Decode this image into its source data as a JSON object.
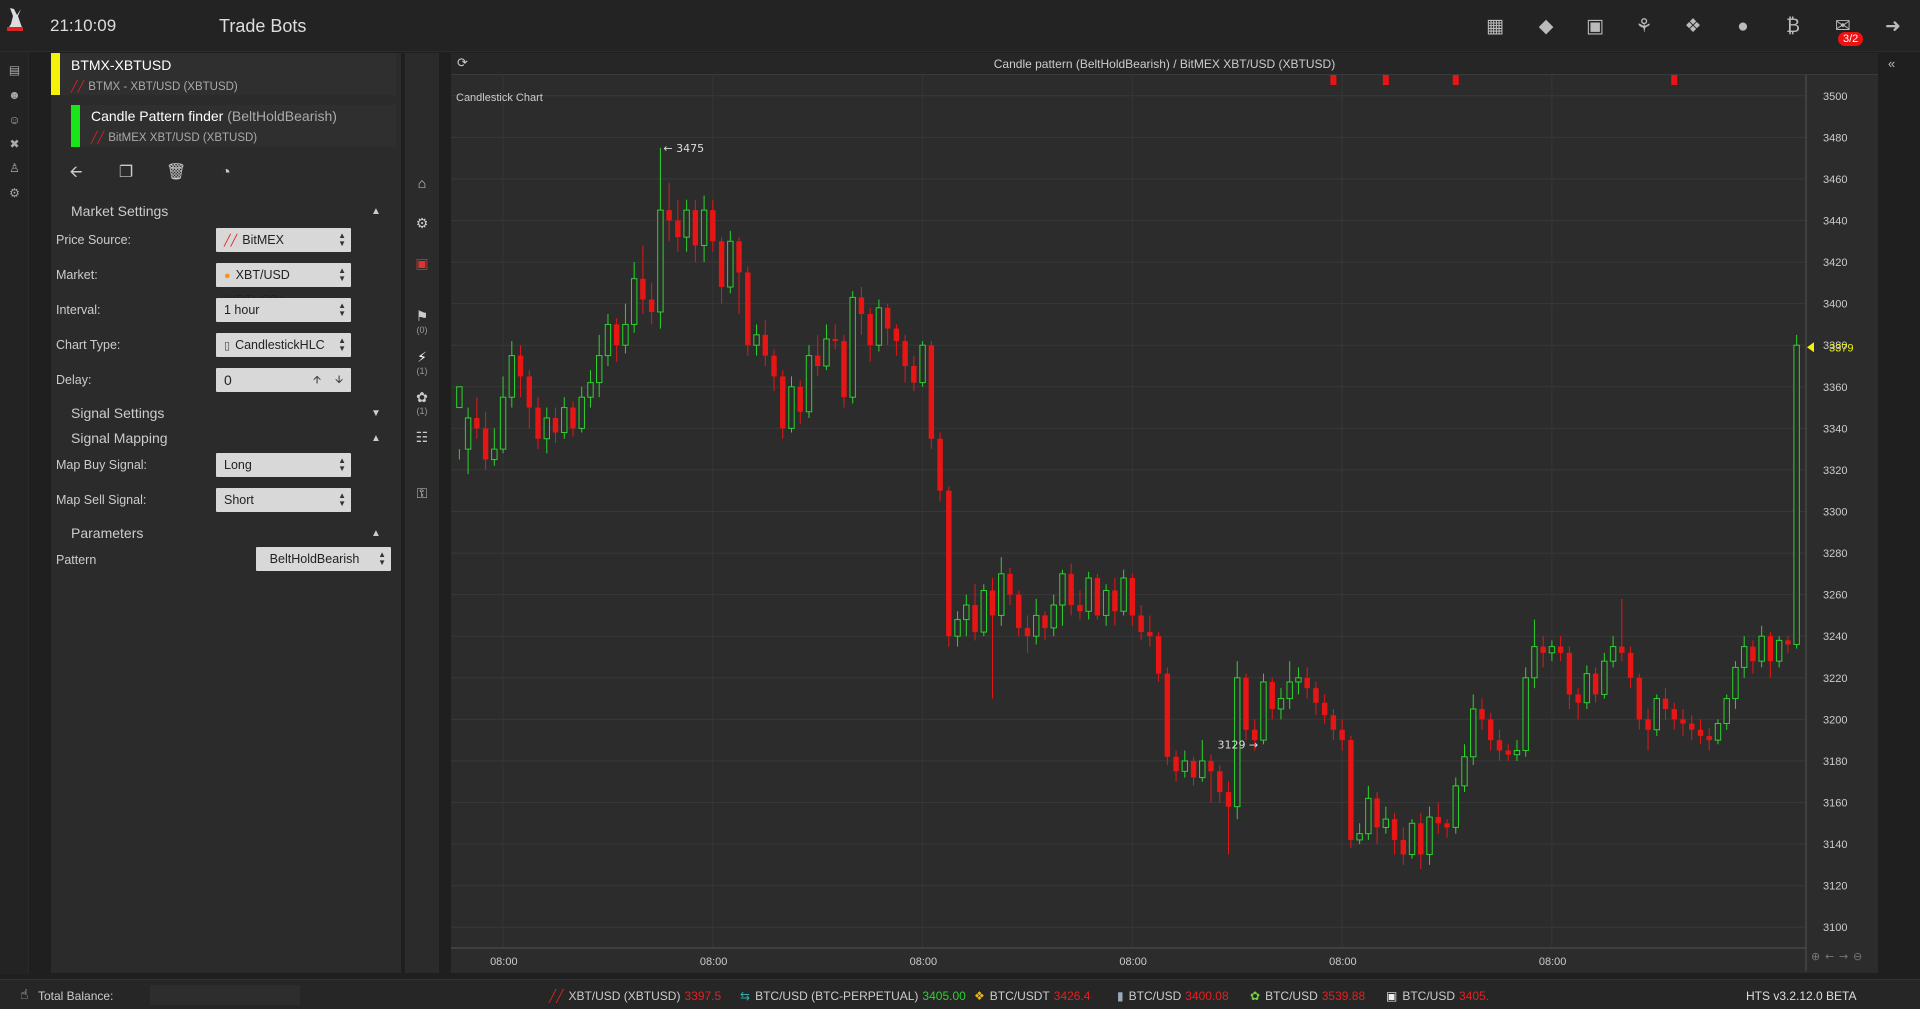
{
  "header": {
    "clock": "21:10:09",
    "title": "Trade Bots",
    "icons": [
      "map-icon",
      "ticket-icon",
      "frame-icon",
      "bell-icon",
      "tag-icon",
      "coins-icon",
      "bitcoin-refresh-icon",
      "inbox-icon",
      "logout-icon"
    ],
    "notification_badge": "3/2"
  },
  "rail": {
    "icons": [
      "monitor-icon",
      "bot-icon",
      "bot-alt-icon",
      "tools-icon",
      "user-icon",
      "cogs-icon"
    ]
  },
  "bots": [
    {
      "name": "BTMX-XBTUSD",
      "subtitle": "BTMX - XBT/USD (XBTUSD)",
      "strip_color": "#f2f20a"
    },
    {
      "name": "Candle Pattern finder",
      "name_suffix": "(BeltHoldBearish)",
      "subtitle": "BitMEX XBT/USD (XBTUSD)",
      "strip_color": "#19e619"
    }
  ],
  "toolbar": {
    "icons": [
      "back-arrow-icon",
      "copy-icon",
      "trash-icon",
      "dashboard-icon"
    ]
  },
  "sections": {
    "market_settings": "Market Settings",
    "signal_settings": "Signal Settings",
    "signal_mapping": "Signal Mapping",
    "parameters": "Parameters"
  },
  "fields": {
    "price_source": {
      "label": "Price Source:",
      "value": "BitMEX"
    },
    "market": {
      "label": "Market:",
      "value": "XBT/USD (XBTUSD)"
    },
    "interval": {
      "label": "Interval:",
      "value": "1 hour"
    },
    "chart_type": {
      "label": "Chart Type:",
      "value": "CandlestickHLC"
    },
    "delay": {
      "label": "Delay:",
      "value": "0"
    },
    "map_buy": {
      "label": "Map Buy Signal:",
      "value": "Long"
    },
    "map_sell": {
      "label": "Map Sell Signal:",
      "value": "Short"
    },
    "pattern": {
      "label": "Pattern",
      "value": "BeltHoldBearish"
    }
  },
  "tool_rail": {
    "icons": [
      "home-icon",
      "cogs-icon",
      "money-icon",
      "flag-icon",
      "bolt-icon",
      "leaf-icon",
      "sitemap-icon",
      "unlock-icon"
    ],
    "counts": {
      "flag": "(0)",
      "bolt": "(1)",
      "leaf": "(1)"
    }
  },
  "chart_panel": {
    "title": "Candle pattern (BeltHoldBearish) / BitMEX XBT/USD (XBTUSD)"
  },
  "chart_data": {
    "type": "candlestick",
    "title": "Candlestick Chart",
    "ylim": [
      3090,
      3510
    ],
    "y_ticks": [
      3100,
      3120,
      3140,
      3160,
      3180,
      3200,
      3220,
      3240,
      3260,
      3280,
      3300,
      3320,
      3340,
      3360,
      3380,
      3400,
      3420,
      3440,
      3460,
      3480,
      3500
    ],
    "x_tick_labels": [
      "08:00",
      "08:00",
      "08:00",
      "08:00",
      "08:00",
      "08:00"
    ],
    "x_tick_indices": [
      5,
      29,
      53,
      77,
      101,
      125
    ],
    "current_price": 3379,
    "high_marker": {
      "label": "3475",
      "index": 23
    },
    "low_marker": {
      "label": "3129",
      "index": 92
    },
    "signal_markers": [
      100,
      106,
      114,
      139
    ],
    "colors": {
      "up": "#2bd32b",
      "down": "#e81515"
    },
    "candles": [
      [
        3350,
        3360,
        3330,
        3325
      ],
      [
        3330,
        3345,
        3350,
        3318
      ],
      [
        3345,
        3340,
        3355,
        3335
      ],
      [
        3340,
        3325,
        3348,
        3320
      ],
      [
        3325,
        3330,
        3340,
        3322
      ],
      [
        3330,
        3355,
        3365,
        3328
      ],
      [
        3355,
        3375,
        3382,
        3350
      ],
      [
        3375,
        3365,
        3380,
        3355
      ],
      [
        3365,
        3350,
        3368,
        3340
      ],
      [
        3350,
        3335,
        3355,
        3330
      ],
      [
        3335,
        3345,
        3350,
        3328
      ],
      [
        3345,
        3338,
        3350,
        3333
      ],
      [
        3338,
        3350,
        3355,
        3335
      ],
      [
        3350,
        3340,
        3353,
        3336
      ],
      [
        3340,
        3355,
        3360,
        3338
      ],
      [
        3355,
        3362,
        3368,
        3350
      ],
      [
        3362,
        3375,
        3385,
        3355
      ],
      [
        3375,
        3390,
        3395,
        3370
      ],
      [
        3390,
        3380,
        3393,
        3372
      ],
      [
        3380,
        3390,
        3400,
        3376
      ],
      [
        3390,
        3412,
        3420,
        3386
      ],
      [
        3412,
        3402,
        3428,
        3395
      ],
      [
        3402,
        3396,
        3410,
        3390
      ],
      [
        3396,
        3445,
        3475,
        3388
      ],
      [
        3445,
        3440,
        3458,
        3430
      ],
      [
        3440,
        3432,
        3450,
        3425
      ],
      [
        3432,
        3445,
        3450,
        3425
      ],
      [
        3445,
        3428,
        3450,
        3420
      ],
      [
        3428,
        3445,
        3452,
        3420
      ],
      [
        3445,
        3430,
        3450,
        3425
      ],
      [
        3430,
        3408,
        3432,
        3400
      ],
      [
        3408,
        3430,
        3435,
        3405
      ],
      [
        3430,
        3415,
        3432,
        3395
      ],
      [
        3415,
        3380,
        3418,
        3375
      ],
      [
        3380,
        3385,
        3390,
        3375
      ],
      [
        3385,
        3375,
        3392,
        3370
      ],
      [
        3375,
        3365,
        3378,
        3358
      ],
      [
        3365,
        3340,
        3368,
        3335
      ],
      [
        3340,
        3360,
        3365,
        3338
      ],
      [
        3360,
        3348,
        3363,
        3342
      ],
      [
        3348,
        3375,
        3380,
        3345
      ],
      [
        3375,
        3370,
        3385,
        3365
      ],
      [
        3370,
        3383,
        3390,
        3368
      ],
      [
        3383,
        3382,
        3390,
        3378
      ],
      [
        3382,
        3355,
        3385,
        3350
      ],
      [
        3355,
        3403,
        3406,
        3352
      ],
      [
        3403,
        3395,
        3408,
        3385
      ],
      [
        3395,
        3380,
        3398,
        3372
      ],
      [
        3380,
        3398,
        3402,
        3377
      ],
      [
        3398,
        3388,
        3400,
        3380
      ],
      [
        3388,
        3382,
        3390,
        3375
      ],
      [
        3382,
        3370,
        3385,
        3362
      ],
      [
        3370,
        3362,
        3375,
        3358
      ],
      [
        3362,
        3380,
        3382,
        3360
      ],
      [
        3380,
        3335,
        3382,
        3330
      ],
      [
        3335,
        3310,
        3338,
        3305
      ],
      [
        3310,
        3240,
        3312,
        3235
      ],
      [
        3240,
        3248,
        3252,
        3235
      ],
      [
        3248,
        3255,
        3260,
        3240
      ],
      [
        3255,
        3242,
        3265,
        3238
      ],
      [
        3242,
        3262,
        3265,
        3240
      ],
      [
        3262,
        3250,
        3268,
        3210
      ],
      [
        3250,
        3270,
        3278,
        3245
      ],
      [
        3270,
        3260,
        3273,
        3255
      ],
      [
        3260,
        3244,
        3262,
        3240
      ],
      [
        3244,
        3240,
        3250,
        3232
      ],
      [
        3240,
        3250,
        3258,
        3236
      ],
      [
        3250,
        3244,
        3252,
        3238
      ],
      [
        3244,
        3255,
        3260,
        3240
      ],
      [
        3255,
        3270,
        3272,
        3245
      ],
      [
        3270,
        3255,
        3275,
        3250
      ],
      [
        3255,
        3252,
        3262,
        3248
      ],
      [
        3252,
        3268,
        3271,
        3248
      ],
      [
        3268,
        3250,
        3270,
        3248
      ],
      [
        3250,
        3262,
        3265,
        3245
      ],
      [
        3262,
        3252,
        3268,
        3245
      ],
      [
        3252,
        3268,
        3272,
        3250
      ],
      [
        3268,
        3250,
        3270,
        3245
      ],
      [
        3250,
        3242,
        3255,
        3238
      ],
      [
        3242,
        3240,
        3250,
        3235
      ],
      [
        3240,
        3222,
        3242,
        3218
      ],
      [
        3222,
        3182,
        3225,
        3178
      ],
      [
        3182,
        3175,
        3185,
        3170
      ],
      [
        3175,
        3180,
        3185,
        3172
      ],
      [
        3180,
        3172,
        3182,
        3168
      ],
      [
        3172,
        3180,
        3190,
        3170
      ],
      [
        3180,
        3175,
        3183,
        3160
      ],
      [
        3175,
        3165,
        3178,
        3160
      ],
      [
        3165,
        3158,
        3170,
        3135
      ],
      [
        3158,
        3220,
        3228,
        3152
      ],
      [
        3220,
        3195,
        3222,
        3190
      ],
      [
        3195,
        3190,
        3200,
        3185
      ],
      [
        3190,
        3218,
        3222,
        3188
      ],
      [
        3218,
        3205,
        3220,
        3200
      ],
      [
        3205,
        3210,
        3215,
        3200
      ],
      [
        3210,
        3218,
        3228,
        3205
      ],
      [
        3218,
        3220,
        3225,
        3212
      ],
      [
        3220,
        3215,
        3225,
        3210
      ],
      [
        3215,
        3208,
        3218,
        3202
      ],
      [
        3208,
        3202,
        3212,
        3198
      ],
      [
        3202,
        3195,
        3205,
        3190
      ],
      [
        3195,
        3190,
        3200,
        3185
      ],
      [
        3190,
        3142,
        3192,
        3138
      ],
      [
        3142,
        3145,
        3150,
        3140
      ],
      [
        3145,
        3162,
        3168,
        3142
      ],
      [
        3162,
        3148,
        3165,
        3140
      ],
      [
        3148,
        3152,
        3158,
        3145
      ],
      [
        3152,
        3142,
        3155,
        3135
      ],
      [
        3142,
        3135,
        3148,
        3130
      ],
      [
        3135,
        3150,
        3152,
        3133
      ],
      [
        3150,
        3135,
        3155,
        3128
      ],
      [
        3135,
        3153,
        3158,
        3130
      ],
      [
        3153,
        3150,
        3160,
        3145
      ],
      [
        3150,
        3148,
        3152,
        3143
      ],
      [
        3148,
        3168,
        3172,
        3145
      ],
      [
        3168,
        3182,
        3188,
        3165
      ],
      [
        3182,
        3205,
        3212,
        3178
      ],
      [
        3205,
        3200,
        3210,
        3195
      ],
      [
        3200,
        3190,
        3203,
        3185
      ],
      [
        3190,
        3185,
        3195,
        3180
      ],
      [
        3185,
        3183,
        3188,
        3180
      ],
      [
        3183,
        3185,
        3190,
        3180
      ],
      [
        3185,
        3220,
        3225,
        3182
      ],
      [
        3220,
        3235,
        3248,
        3215
      ],
      [
        3235,
        3232,
        3240,
        3225
      ],
      [
        3232,
        3235,
        3238,
        3228
      ],
      [
        3235,
        3232,
        3240,
        3228
      ],
      [
        3232,
        3212,
        3235,
        3205
      ],
      [
        3212,
        3208,
        3215,
        3200
      ],
      [
        3208,
        3222,
        3226,
        3205
      ],
      [
        3222,
        3212,
        3225,
        3208
      ],
      [
        3212,
        3228,
        3232,
        3210
      ],
      [
        3228,
        3235,
        3240,
        3225
      ],
      [
        3235,
        3232,
        3258,
        3228
      ],
      [
        3232,
        3220,
        3235,
        3215
      ],
      [
        3220,
        3200,
        3222,
        3195
      ],
      [
        3200,
        3195,
        3205,
        3185
      ],
      [
        3195,
        3210,
        3212,
        3192
      ],
      [
        3210,
        3205,
        3215,
        3200
      ],
      [
        3205,
        3200,
        3208,
        3195
      ],
      [
        3200,
        3198,
        3205,
        3192
      ],
      [
        3198,
        3195,
        3202,
        3190
      ],
      [
        3195,
        3192,
        3200,
        3188
      ],
      [
        3192,
        3190,
        3196,
        3185
      ],
      [
        3190,
        3198,
        3200,
        3188
      ],
      [
        3198,
        3210,
        3212,
        3195
      ],
      [
        3210,
        3225,
        3228,
        3205
      ],
      [
        3225,
        3235,
        3240,
        3220
      ],
      [
        3235,
        3228,
        3238,
        3222
      ],
      [
        3228,
        3240,
        3245,
        3225
      ],
      [
        3240,
        3228,
        3242,
        3220
      ],
      [
        3228,
        3238,
        3240,
        3225
      ],
      [
        3238,
        3236,
        3240,
        3232
      ],
      [
        3236,
        3380,
        3385,
        3234
      ]
    ]
  },
  "statusbar": {
    "balance_label": "Total Balance:",
    "version": "HTS v3.2.12.0 BETA",
    "tickers": [
      {
        "pair": "XBT/USD (XBTUSD)",
        "price": "3397.5",
        "dir": "down",
        "icon": "bitmex-icon"
      },
      {
        "pair": "BTC/USD (BTC-PERPETUAL)",
        "price": "3405.00",
        "dir": "up",
        "icon": "deribit-icon"
      },
      {
        "pair": "BTC/USDT",
        "price": "3426.4",
        "dir": "down",
        "icon": "binance-icon"
      },
      {
        "pair": "BTC/USD",
        "price": "3400.08",
        "dir": "down",
        "icon": "bitfinex-icon"
      },
      {
        "pair": "BTC/USD",
        "price": "3539.88",
        "dir": "down",
        "icon": "leaf-exchange-icon"
      },
      {
        "pair": "BTC/USD",
        "price": "3405.",
        "dir": "down",
        "icon": "exchange-icon"
      }
    ]
  }
}
